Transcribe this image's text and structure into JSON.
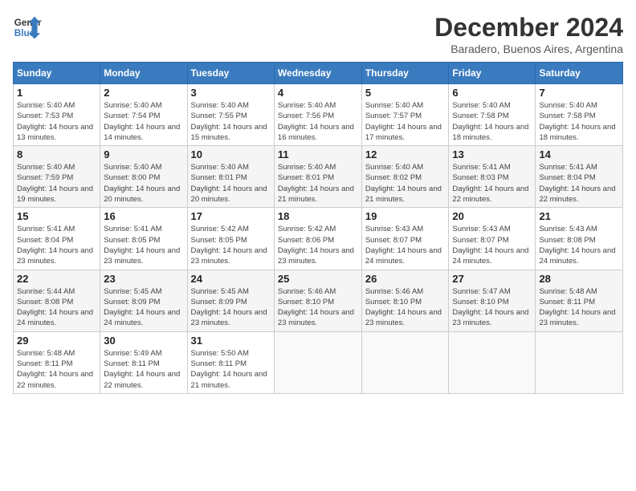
{
  "logo": {
    "line1": "General",
    "line2": "Blue"
  },
  "title": "December 2024",
  "subtitle": "Baradero, Buenos Aires, Argentina",
  "weekdays": [
    "Sunday",
    "Monday",
    "Tuesday",
    "Wednesday",
    "Thursday",
    "Friday",
    "Saturday"
  ],
  "weeks": [
    [
      {
        "day": "1",
        "sunrise": "Sunrise: 5:40 AM",
        "sunset": "Sunset: 7:53 PM",
        "daylight": "Daylight: 14 hours and 13 minutes."
      },
      {
        "day": "2",
        "sunrise": "Sunrise: 5:40 AM",
        "sunset": "Sunset: 7:54 PM",
        "daylight": "Daylight: 14 hours and 14 minutes."
      },
      {
        "day": "3",
        "sunrise": "Sunrise: 5:40 AM",
        "sunset": "Sunset: 7:55 PM",
        "daylight": "Daylight: 14 hours and 15 minutes."
      },
      {
        "day": "4",
        "sunrise": "Sunrise: 5:40 AM",
        "sunset": "Sunset: 7:56 PM",
        "daylight": "Daylight: 14 hours and 16 minutes."
      },
      {
        "day": "5",
        "sunrise": "Sunrise: 5:40 AM",
        "sunset": "Sunset: 7:57 PM",
        "daylight": "Daylight: 14 hours and 17 minutes."
      },
      {
        "day": "6",
        "sunrise": "Sunrise: 5:40 AM",
        "sunset": "Sunset: 7:58 PM",
        "daylight": "Daylight: 14 hours and 18 minutes."
      },
      {
        "day": "7",
        "sunrise": "Sunrise: 5:40 AM",
        "sunset": "Sunset: 7:58 PM",
        "daylight": "Daylight: 14 hours and 18 minutes."
      }
    ],
    [
      {
        "day": "8",
        "sunrise": "Sunrise: 5:40 AM",
        "sunset": "Sunset: 7:59 PM",
        "daylight": "Daylight: 14 hours and 19 minutes."
      },
      {
        "day": "9",
        "sunrise": "Sunrise: 5:40 AM",
        "sunset": "Sunset: 8:00 PM",
        "daylight": "Daylight: 14 hours and 20 minutes."
      },
      {
        "day": "10",
        "sunrise": "Sunrise: 5:40 AM",
        "sunset": "Sunset: 8:01 PM",
        "daylight": "Daylight: 14 hours and 20 minutes."
      },
      {
        "day": "11",
        "sunrise": "Sunrise: 5:40 AM",
        "sunset": "Sunset: 8:01 PM",
        "daylight": "Daylight: 14 hours and 21 minutes."
      },
      {
        "day": "12",
        "sunrise": "Sunrise: 5:40 AM",
        "sunset": "Sunset: 8:02 PM",
        "daylight": "Daylight: 14 hours and 21 minutes."
      },
      {
        "day": "13",
        "sunrise": "Sunrise: 5:41 AM",
        "sunset": "Sunset: 8:03 PM",
        "daylight": "Daylight: 14 hours and 22 minutes."
      },
      {
        "day": "14",
        "sunrise": "Sunrise: 5:41 AM",
        "sunset": "Sunset: 8:04 PM",
        "daylight": "Daylight: 14 hours and 22 minutes."
      }
    ],
    [
      {
        "day": "15",
        "sunrise": "Sunrise: 5:41 AM",
        "sunset": "Sunset: 8:04 PM",
        "daylight": "Daylight: 14 hours and 23 minutes."
      },
      {
        "day": "16",
        "sunrise": "Sunrise: 5:41 AM",
        "sunset": "Sunset: 8:05 PM",
        "daylight": "Daylight: 14 hours and 23 minutes."
      },
      {
        "day": "17",
        "sunrise": "Sunrise: 5:42 AM",
        "sunset": "Sunset: 8:05 PM",
        "daylight": "Daylight: 14 hours and 23 minutes."
      },
      {
        "day": "18",
        "sunrise": "Sunrise: 5:42 AM",
        "sunset": "Sunset: 8:06 PM",
        "daylight": "Daylight: 14 hours and 23 minutes."
      },
      {
        "day": "19",
        "sunrise": "Sunrise: 5:43 AM",
        "sunset": "Sunset: 8:07 PM",
        "daylight": "Daylight: 14 hours and 24 minutes."
      },
      {
        "day": "20",
        "sunrise": "Sunrise: 5:43 AM",
        "sunset": "Sunset: 8:07 PM",
        "daylight": "Daylight: 14 hours and 24 minutes."
      },
      {
        "day": "21",
        "sunrise": "Sunrise: 5:43 AM",
        "sunset": "Sunset: 8:08 PM",
        "daylight": "Daylight: 14 hours and 24 minutes."
      }
    ],
    [
      {
        "day": "22",
        "sunrise": "Sunrise: 5:44 AM",
        "sunset": "Sunset: 8:08 PM",
        "daylight": "Daylight: 14 hours and 24 minutes."
      },
      {
        "day": "23",
        "sunrise": "Sunrise: 5:45 AM",
        "sunset": "Sunset: 8:09 PM",
        "daylight": "Daylight: 14 hours and 24 minutes."
      },
      {
        "day": "24",
        "sunrise": "Sunrise: 5:45 AM",
        "sunset": "Sunset: 8:09 PM",
        "daylight": "Daylight: 14 hours and 23 minutes."
      },
      {
        "day": "25",
        "sunrise": "Sunrise: 5:46 AM",
        "sunset": "Sunset: 8:10 PM",
        "daylight": "Daylight: 14 hours and 23 minutes."
      },
      {
        "day": "26",
        "sunrise": "Sunrise: 5:46 AM",
        "sunset": "Sunset: 8:10 PM",
        "daylight": "Daylight: 14 hours and 23 minutes."
      },
      {
        "day": "27",
        "sunrise": "Sunrise: 5:47 AM",
        "sunset": "Sunset: 8:10 PM",
        "daylight": "Daylight: 14 hours and 23 minutes."
      },
      {
        "day": "28",
        "sunrise": "Sunrise: 5:48 AM",
        "sunset": "Sunset: 8:11 PM",
        "daylight": "Daylight: 14 hours and 23 minutes."
      }
    ],
    [
      {
        "day": "29",
        "sunrise": "Sunrise: 5:48 AM",
        "sunset": "Sunset: 8:11 PM",
        "daylight": "Daylight: 14 hours and 22 minutes."
      },
      {
        "day": "30",
        "sunrise": "Sunrise: 5:49 AM",
        "sunset": "Sunset: 8:11 PM",
        "daylight": "Daylight: 14 hours and 22 minutes."
      },
      {
        "day": "31",
        "sunrise": "Sunrise: 5:50 AM",
        "sunset": "Sunset: 8:11 PM",
        "daylight": "Daylight: 14 hours and 21 minutes."
      },
      null,
      null,
      null,
      null
    ]
  ]
}
